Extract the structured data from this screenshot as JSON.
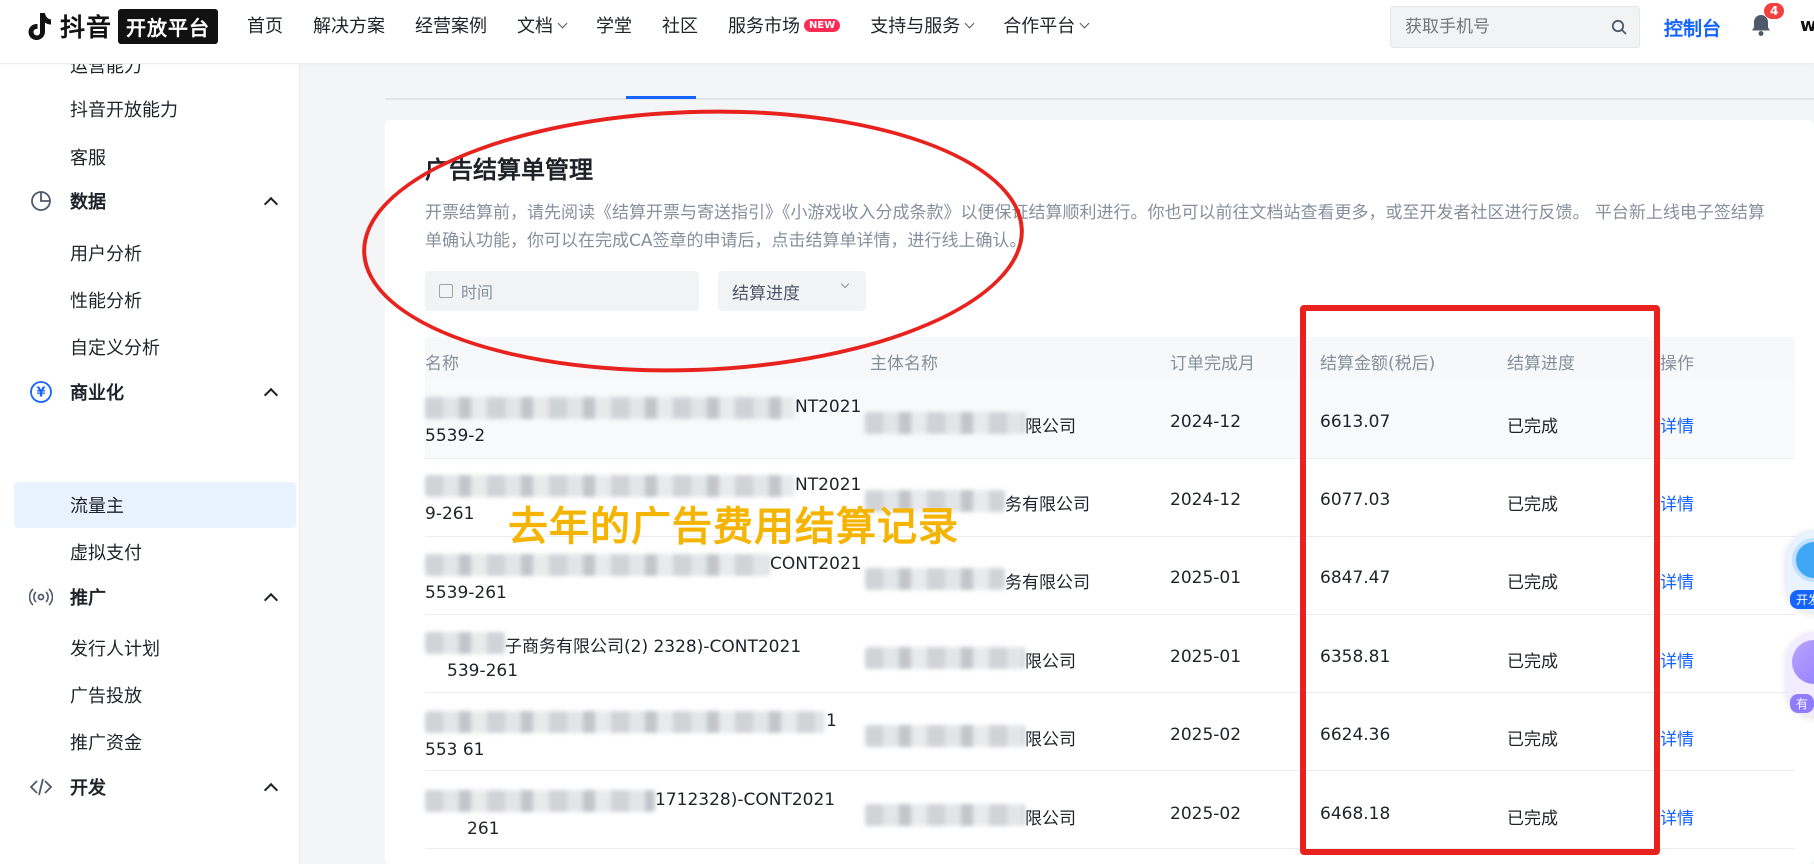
{
  "brand": {
    "name": "抖音",
    "badge": "开放平台"
  },
  "nav": {
    "items": [
      {
        "label": "首页",
        "dropdown": false
      },
      {
        "label": "解决方案",
        "dropdown": false
      },
      {
        "label": "经营案例",
        "dropdown": false
      },
      {
        "label": "文档",
        "dropdown": true
      },
      {
        "label": "学堂",
        "dropdown": false
      },
      {
        "label": "社区",
        "dropdown": false
      },
      {
        "label": "服务市场",
        "dropdown": false,
        "badge": "NEW"
      },
      {
        "label": "支持与服务",
        "dropdown": true
      },
      {
        "label": "合作平台",
        "dropdown": true
      }
    ],
    "search_placeholder": "获取手机号",
    "console": "控制台",
    "notification_count": "4",
    "avatar_initial": "w"
  },
  "sidebar": {
    "items": [
      {
        "type": "sub",
        "label": "运营能力"
      },
      {
        "type": "sub",
        "label": "抖音开放能力"
      },
      {
        "type": "sub",
        "label": "客服"
      },
      {
        "type": "group",
        "label": "数据",
        "icon": "pie-chart-icon"
      },
      {
        "type": "sub",
        "label": "用户分析"
      },
      {
        "type": "sub",
        "label": "性能分析"
      },
      {
        "type": "sub",
        "label": "自定义分析"
      },
      {
        "type": "group",
        "label": "商业化",
        "icon": "yuan-icon"
      },
      {
        "type": "sub",
        "label": "流量主",
        "active": true
      },
      {
        "type": "sub",
        "label": "虚拟支付"
      },
      {
        "type": "group",
        "label": "推广",
        "icon": "broadcast-icon"
      },
      {
        "type": "sub",
        "label": "发行人计划"
      },
      {
        "type": "sub",
        "label": "广告投放"
      },
      {
        "type": "sub",
        "label": "推广资金"
      },
      {
        "type": "group",
        "label": "开发",
        "icon": "code-icon"
      }
    ]
  },
  "main": {
    "title": "广告结算单管理",
    "description": "开票结算前，请先阅读《结算开票与寄送指引》《小游戏收入分成条款》以便保证结算顺利进行。你也可以前往文档站查看更多，或至开发者社区进行反馈。 平台新上线电子签结算单确认功能，你可以在完成CA签章的申请后，点击结算单详情，进行线上确认。",
    "filters": {
      "time_placeholder": "时间",
      "progress_placeholder": "结算进度"
    },
    "table": {
      "columns": [
        "名称",
        "主体名称",
        "订单完成月",
        "结算金额(税后)",
        "结算进度",
        "操作"
      ],
      "rows": [
        {
          "name_line1_visible": "NT2021",
          "name_line2_visible": "5539-2",
          "entity_visible": "限公司",
          "month": "2024-12",
          "amount": "6613.07",
          "status": "已完成",
          "action": "详情"
        },
        {
          "name_line1_visible": "NT2021",
          "name_line2_visible": "9-261",
          "entity_visible": "务有限公司",
          "month": "2024-12",
          "amount": "6077.03",
          "status": "已完成",
          "action": "详情"
        },
        {
          "name_line1_visible": "CONT2021",
          "name_line2_visible": "5539-261",
          "entity_visible": "务有限公司",
          "month": "2025-01",
          "amount": "6847.47",
          "status": "已完成",
          "action": "详情"
        },
        {
          "name_line1_visible": "子商务有限公司(2)        2328)-CONT2021",
          "name_line2_visible": "539-261",
          "entity_visible": "限公司",
          "month": "2025-01",
          "amount": "6358.81",
          "status": "已完成",
          "action": "详情"
        },
        {
          "name_line1_visible": "1",
          "name_line2_visible": "553   61",
          "entity_visible": "限公司",
          "month": "2025-02",
          "amount": "6624.36",
          "status": "已完成",
          "action": "详情"
        },
        {
          "name_line1_visible": "1712328)-CONT2021",
          "name_line2_visible": "261",
          "entity_visible": "限公司",
          "month": "2025-02",
          "amount": "6468.18",
          "status": "已完成",
          "action": "详情"
        }
      ]
    }
  },
  "annotation": {
    "text": "去年的广告费用结算记录",
    "color": "#f4b400",
    "highlight_color": "#e8231f"
  },
  "floating": {
    "assistant_a_label": "开发",
    "assistant_b_label": "有"
  },
  "colors": {
    "accent": "#1664ff",
    "active_bg": "#e8f3ff",
    "new_badge": "#fe2c55"
  }
}
